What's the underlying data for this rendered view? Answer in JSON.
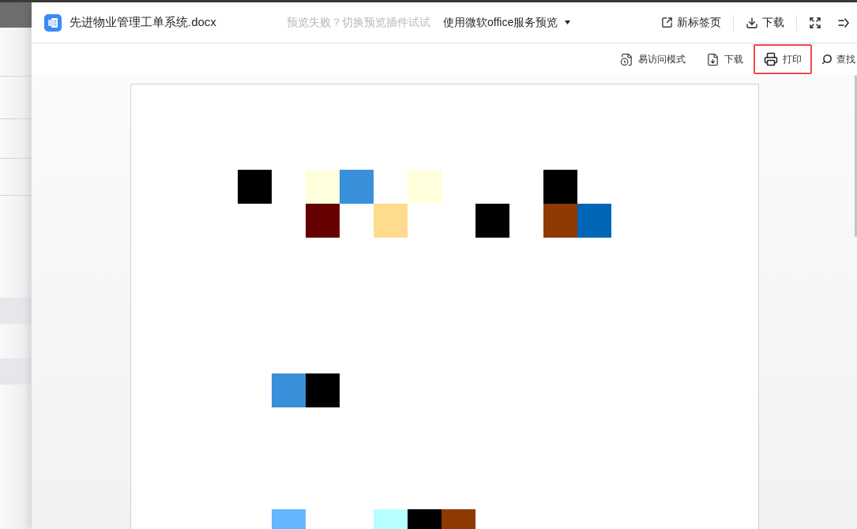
{
  "file": {
    "name": "先进物业管理工单系统.docx"
  },
  "header": {
    "fallback_hint": "预览失败？切换预览插件试试",
    "preview_mode": {
      "label": "使用微软office服务预览"
    },
    "actions": [
      {
        "kind": "new_tab",
        "label": "新标签页"
      },
      {
        "kind": "download",
        "label": "下载"
      },
      {
        "kind": "fullscreen"
      },
      {
        "kind": "collapse"
      }
    ]
  },
  "toolbar": {
    "items": [
      {
        "kind": "accessibility",
        "label": "易访问模式",
        "highlighted": false
      },
      {
        "kind": "download",
        "label": "下载",
        "highlighted": false
      },
      {
        "kind": "print",
        "label": "打印",
        "highlighted": true
      },
      {
        "kind": "find",
        "label": "查找",
        "highlighted": false
      }
    ]
  },
  "document": {
    "rows": [
      {
        "kind": "cells",
        "cells": [
          {
            "kind": "filled",
            "color": "#000000"
          },
          {
            "kind": "blank"
          },
          {
            "kind": "filled",
            "color": "#ffffdb"
          },
          {
            "kind": "filled",
            "color": "#3a8fdb"
          },
          {
            "kind": "blank"
          },
          {
            "kind": "filled",
            "color": "#ffffdb"
          },
          {
            "kind": "blank"
          },
          {
            "kind": "blank"
          },
          {
            "kind": "blank"
          },
          {
            "kind": "filled",
            "color": "#000000"
          }
        ]
      },
      {
        "kind": "cells",
        "cells": [
          {
            "kind": "blank"
          },
          {
            "kind": "blank"
          },
          {
            "kind": "filled",
            "color": "#660000"
          },
          {
            "kind": "blank"
          },
          {
            "kind": "filled",
            "color": "#ffdb90"
          },
          {
            "kind": "blank"
          },
          {
            "kind": "blank"
          },
          {
            "kind": "filled",
            "color": "#000000"
          },
          {
            "kind": "blank"
          },
          {
            "kind": "filled",
            "color": "#8f3a00"
          },
          {
            "kind": "filled",
            "color": "#0066b6"
          }
        ]
      },
      {
        "kind": "blank"
      },
      {
        "kind": "blank"
      },
      {
        "kind": "blank"
      },
      {
        "kind": "blank"
      },
      {
        "kind": "cells",
        "cells": [
          {
            "kind": "blank"
          },
          {
            "kind": "filled",
            "color": "#3a8fdb"
          },
          {
            "kind": "filled",
            "color": "#000000"
          }
        ]
      },
      {
        "kind": "blank"
      },
      {
        "kind": "blank"
      },
      {
        "kind": "blank"
      },
      {
        "kind": "cells",
        "cells": [
          {
            "kind": "blank"
          },
          {
            "kind": "filled",
            "color": "#66b6ff"
          },
          {
            "kind": "blank"
          },
          {
            "kind": "blank"
          },
          {
            "kind": "filled",
            "color": "#b6ffff"
          },
          {
            "kind": "filled",
            "color": "#000000"
          },
          {
            "kind": "filled",
            "color": "#8f3a00"
          }
        ]
      }
    ]
  }
}
